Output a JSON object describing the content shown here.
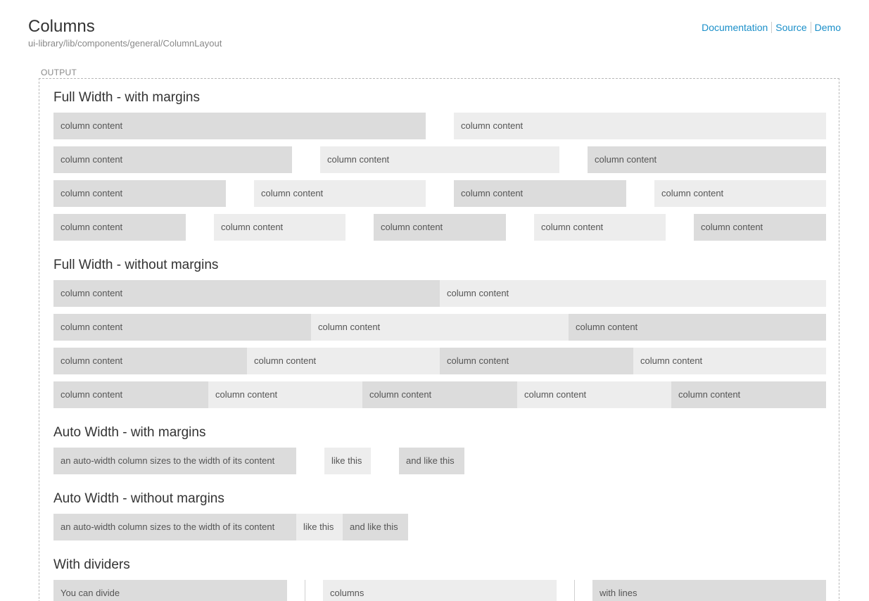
{
  "header": {
    "title": "Columns",
    "path": "ui-library/lib/components/general/ColumnLayout",
    "links": [
      "Documentation",
      "Source",
      "Demo"
    ]
  },
  "output_label": "OUTPUT",
  "col_text": "column content",
  "sections": {
    "full_with_margins": "Full Width - with margins",
    "full_without_margins": "Full Width - without margins",
    "auto_with_margins": "Auto Width - with margins",
    "auto_without_margins": "Auto Width - without margins",
    "with_dividers": "With dividers"
  },
  "auto": {
    "first": "an auto-width column sizes to the width of its content",
    "second": "like this",
    "third": "and like this"
  },
  "dividers": {
    "first": "You can divide",
    "second": "columns",
    "third": "with lines"
  }
}
